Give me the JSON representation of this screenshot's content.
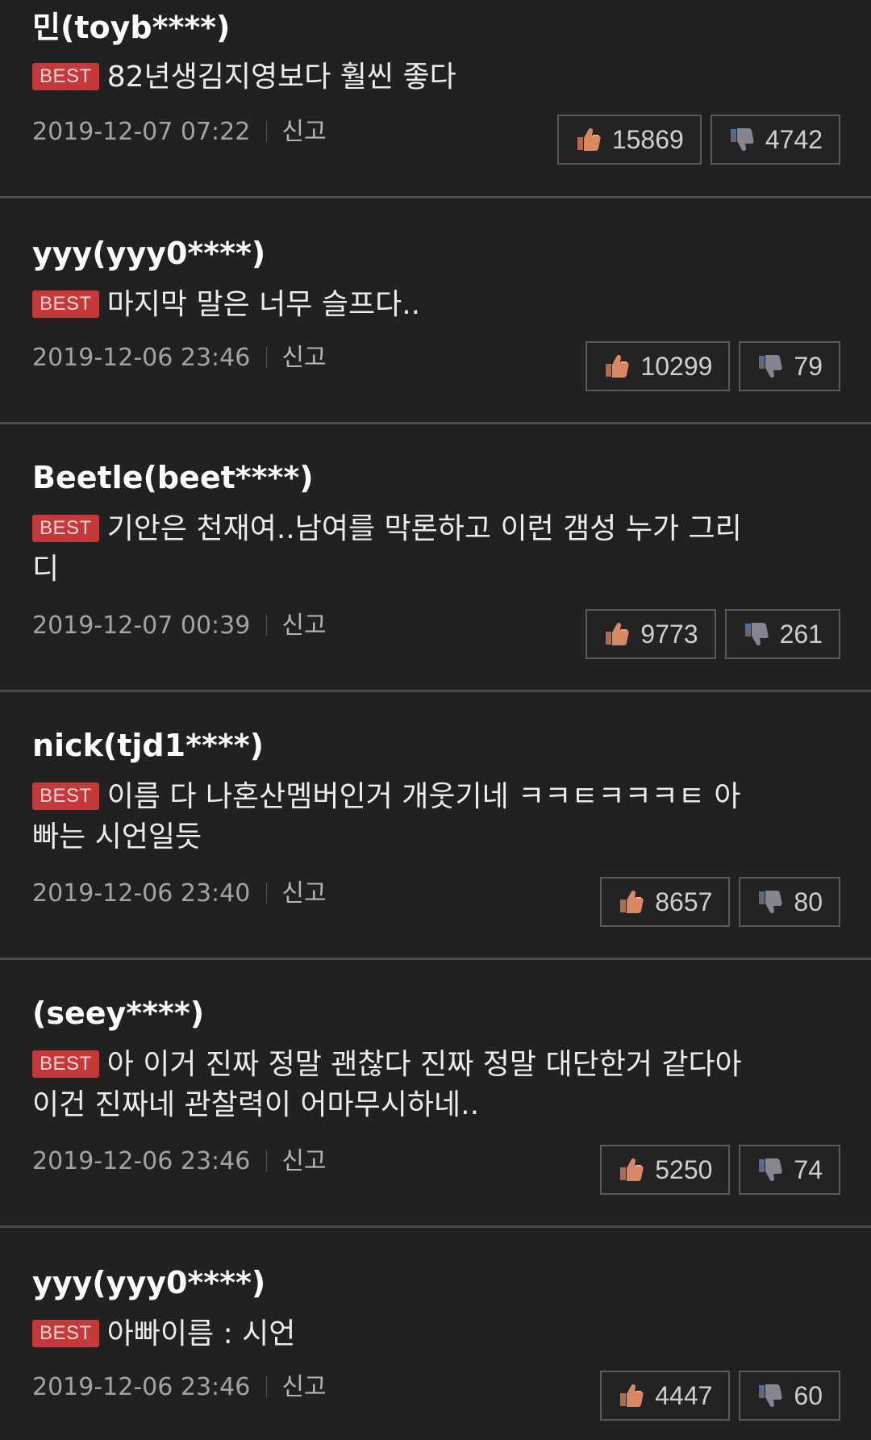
{
  "colors": {
    "background": "#212121",
    "best_badge": "#c43a3a",
    "divider": "#4a4a4a",
    "like_icon": "#d88863",
    "dislike_icon": "#7d7d86"
  },
  "report_label": "신고",
  "best_label": "BEST",
  "comments": [
    {
      "user": "민(toyb****)",
      "best": true,
      "lines": [
        "82년생김지영보다 훨씬 좋다"
      ],
      "date": "2019-12-07 07:22",
      "likes": "15869",
      "dislikes": "4742"
    },
    {
      "user": "yyy(yyy0****)",
      "best": true,
      "lines": [
        "마지막 말은 너무 슬프다.."
      ],
      "date": "2019-12-06 23:46",
      "likes": "10299",
      "dislikes": "79"
    },
    {
      "user": "Beetle(beet****)",
      "best": true,
      "lines": [
        "기안은 천재여..남여를 막론하고 이런 갬성 누가 그리",
        "디"
      ],
      "date": "2019-12-07 00:39",
      "likes": "9773",
      "dislikes": "261"
    },
    {
      "user": "nick(tjd1****)",
      "best": true,
      "lines": [
        "이름 다 나혼산멤버인거 개웃기네 ㅋㅋㅌㅋㅋㅋㅌ 아",
        "빠는 시언일듯"
      ],
      "date": "2019-12-06 23:40",
      "likes": "8657",
      "dislikes": "80"
    },
    {
      "user": "(seey****)",
      "best": true,
      "lines": [
        "아 이거 진짜 정말 괜찮다 진짜 정말 대단한거 같다아",
        "이건 진짜네 관찰력이 어마무시하네.."
      ],
      "date": "2019-12-06 23:46",
      "likes": "5250",
      "dislikes": "74"
    },
    {
      "user": "yyy(yyy0****)",
      "best": true,
      "lines": [
        "아빠이름 : 시언"
      ],
      "date": "2019-12-06 23:46",
      "likes": "4447",
      "dislikes": "60"
    }
  ]
}
